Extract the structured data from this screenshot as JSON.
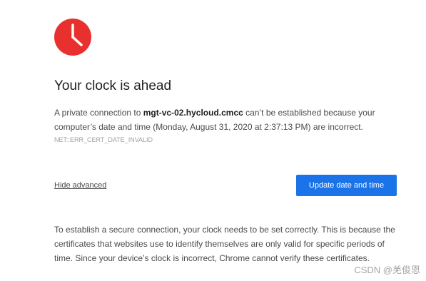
{
  "error_page": {
    "icon": "clock-icon",
    "icon_color": "#e8312f",
    "title": "Your clock is ahead",
    "message_prefix": "A private connection to ",
    "host": "mgt-vc-02.hycloud.cmcc",
    "message_suffix": " can’t be established because your computer’s date and time (Monday, August 31, 2020 at 2:37:13 PM) are incorrect.",
    "error_code": "NET::ERR_CERT_DATE_INVALID",
    "hide_advanced_label": "Hide advanced",
    "update_button_label": "Update date and time",
    "button_color": "#1a73e8",
    "details": "To establish a secure connection, your clock needs to be set correctly. This is because the certificates that websites use to identify themselves are only valid for specific periods of time. Since your device’s clock is incorrect, Chrome cannot verify these certificates."
  },
  "watermark": {
    "text": "CSDN @羌俊恩"
  }
}
